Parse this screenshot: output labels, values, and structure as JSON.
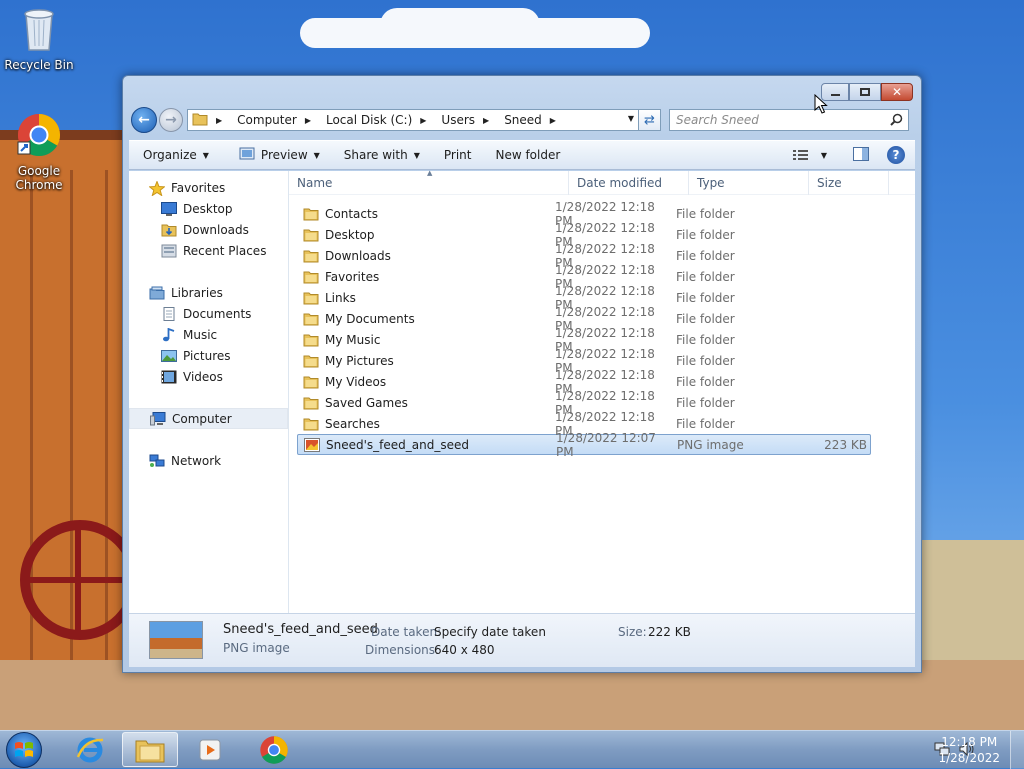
{
  "desktop": {
    "icons": [
      {
        "label": "Recycle Bin",
        "icon": "recycle-bin-icon"
      },
      {
        "label": "Google Chrome",
        "icon": "chrome-icon"
      }
    ]
  },
  "window": {
    "address": {
      "crumbs": [
        "Computer",
        "Local Disk (C:)",
        "Users",
        "Sneed"
      ]
    },
    "search": {
      "placeholder": "Search Sneed"
    },
    "toolbar": {
      "organize": "Organize",
      "preview": "Preview",
      "share_with": "Share with",
      "print": "Print",
      "new_folder": "New folder"
    },
    "nav": {
      "favorites": "Favorites",
      "favorites_items": [
        "Desktop",
        "Downloads",
        "Recent Places"
      ],
      "libraries": "Libraries",
      "libraries_items": [
        "Documents",
        "Music",
        "Pictures",
        "Videos"
      ],
      "computer": "Computer",
      "network": "Network"
    },
    "columns": {
      "name": "Name",
      "date": "Date modified",
      "type": "Type",
      "size": "Size"
    },
    "files": [
      {
        "name": "Contacts",
        "date": "1/28/2022 12:18 PM",
        "type": "File folder",
        "size": ""
      },
      {
        "name": "Desktop",
        "date": "1/28/2022 12:18 PM",
        "type": "File folder",
        "size": ""
      },
      {
        "name": "Downloads",
        "date": "1/28/2022 12:18 PM",
        "type": "File folder",
        "size": ""
      },
      {
        "name": "Favorites",
        "date": "1/28/2022 12:18 PM",
        "type": "File folder",
        "size": ""
      },
      {
        "name": "Links",
        "date": "1/28/2022 12:18 PM",
        "type": "File folder",
        "size": ""
      },
      {
        "name": "My Documents",
        "date": "1/28/2022 12:18 PM",
        "type": "File folder",
        "size": ""
      },
      {
        "name": "My Music",
        "date": "1/28/2022 12:18 PM",
        "type": "File folder",
        "size": ""
      },
      {
        "name": "My Pictures",
        "date": "1/28/2022 12:18 PM",
        "type": "File folder",
        "size": ""
      },
      {
        "name": "My Videos",
        "date": "1/28/2022 12:18 PM",
        "type": "File folder",
        "size": ""
      },
      {
        "name": "Saved Games",
        "date": "1/28/2022 12:18 PM",
        "type": "File folder",
        "size": ""
      },
      {
        "name": "Searches",
        "date": "1/28/2022 12:18 PM",
        "type": "File folder",
        "size": ""
      },
      {
        "name": "Sneed's_feed_and_seed",
        "date": "1/28/2022 12:07 PM",
        "type": "PNG image",
        "size": "223 KB"
      }
    ],
    "details": {
      "name": "Sneed's_feed_and_seed",
      "kind": "PNG image",
      "date_taken_label": "Date taken:",
      "date_taken_value": "Specify date taken",
      "dimensions_label": "Dimensions:",
      "dimensions_value": "640 x 480",
      "size_label": "Size:",
      "size_value": "222 KB"
    }
  },
  "taskbar": {
    "clock_time": "12:18 PM",
    "clock_date": "1/28/2022"
  }
}
